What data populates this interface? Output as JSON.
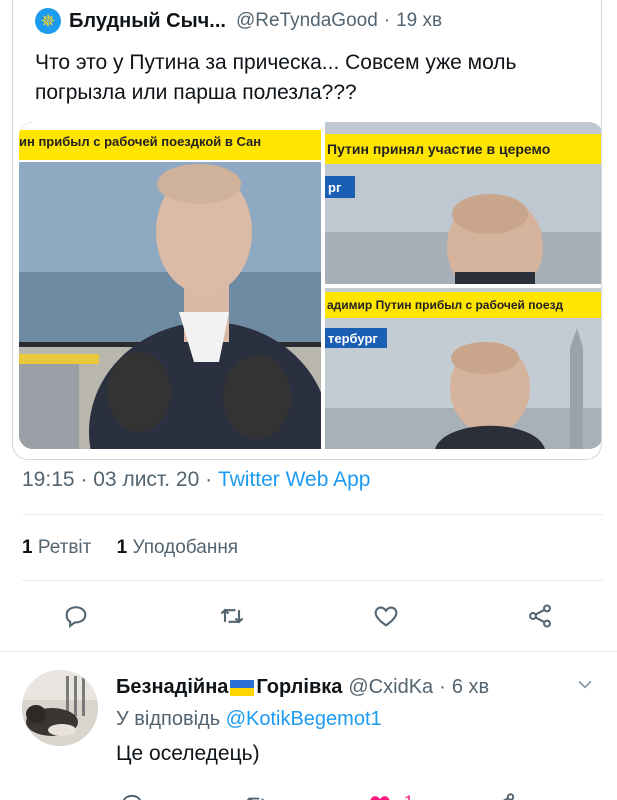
{
  "quoted_tweet": {
    "author_name": "Блудный Сыч...",
    "author_handle": "@ReTyndaGood",
    "separator": "·",
    "time_ago": "19 хв",
    "text": "Что это у Путина за прическа... Совсем уже моль погрызла или парша полезла???",
    "media": {
      "left_caption": "ин прибыл с рабочей поездкой в Сан",
      "top_right_caption": "Путин принял участие в церемо",
      "top_right_tag": "рг",
      "bottom_right_caption": "адимир Путин прибыл с рабочей поезд",
      "bottom_right_tag": "тербург"
    }
  },
  "tweet_meta": {
    "time": "19:15",
    "date": "03 лист. 20",
    "separator": "·",
    "app": "Twitter Web App"
  },
  "stats": {
    "retweets_count": "1",
    "retweets_label": "Ретвіт",
    "likes_count": "1",
    "likes_label": "Уподобання"
  },
  "actions": {
    "icons": [
      "reply-icon",
      "retweet-icon",
      "like-icon",
      "share-icon"
    ]
  },
  "reply": {
    "author_name_part1": "Безнадійна",
    "author_name_part2": "Горлівка",
    "author_handle": "@CxidKa",
    "separator": "·",
    "time_ago": "6 хв",
    "replying_to_label": "У відповідь",
    "replying_to_handle": "@KotikBegemot1",
    "text": "Це оселедець)",
    "like_count": "1"
  },
  "colors": {
    "accent": "#1d9bf0",
    "secondary_text": "#536471",
    "like_active": "#f91880",
    "caption_bar": "#ffe500"
  }
}
